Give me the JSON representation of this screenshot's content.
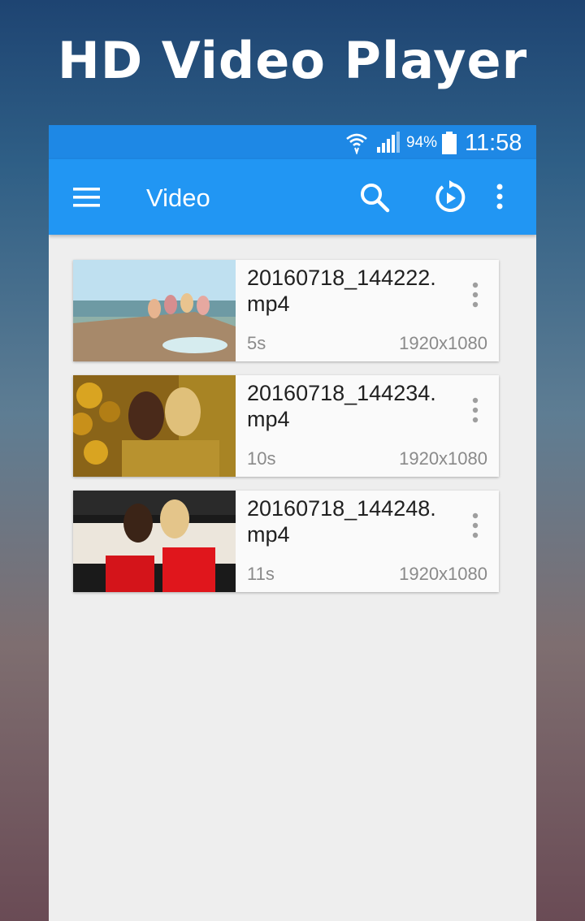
{
  "promo": {
    "title": "HD Video Player"
  },
  "status_bar": {
    "battery": "94%",
    "time": "11:58"
  },
  "app_bar": {
    "title": "Video",
    "icons": [
      "menu-icon",
      "search-icon",
      "resume-play-icon",
      "overflow-menu-icon"
    ]
  },
  "colors": {
    "status_bar": "#1e88e5",
    "app_bar": "#2196f3",
    "list_bg": "#eeeeee"
  },
  "videos": [
    {
      "name": "20160718_144222.mp4",
      "duration": "5s",
      "resolution": "1920x1080"
    },
    {
      "name": "20160718_144234.mp4",
      "duration": "10s",
      "resolution": "1920x1080"
    },
    {
      "name": "20160718_144248.mp4",
      "duration": "11s",
      "resolution": "1920x1080"
    }
  ]
}
